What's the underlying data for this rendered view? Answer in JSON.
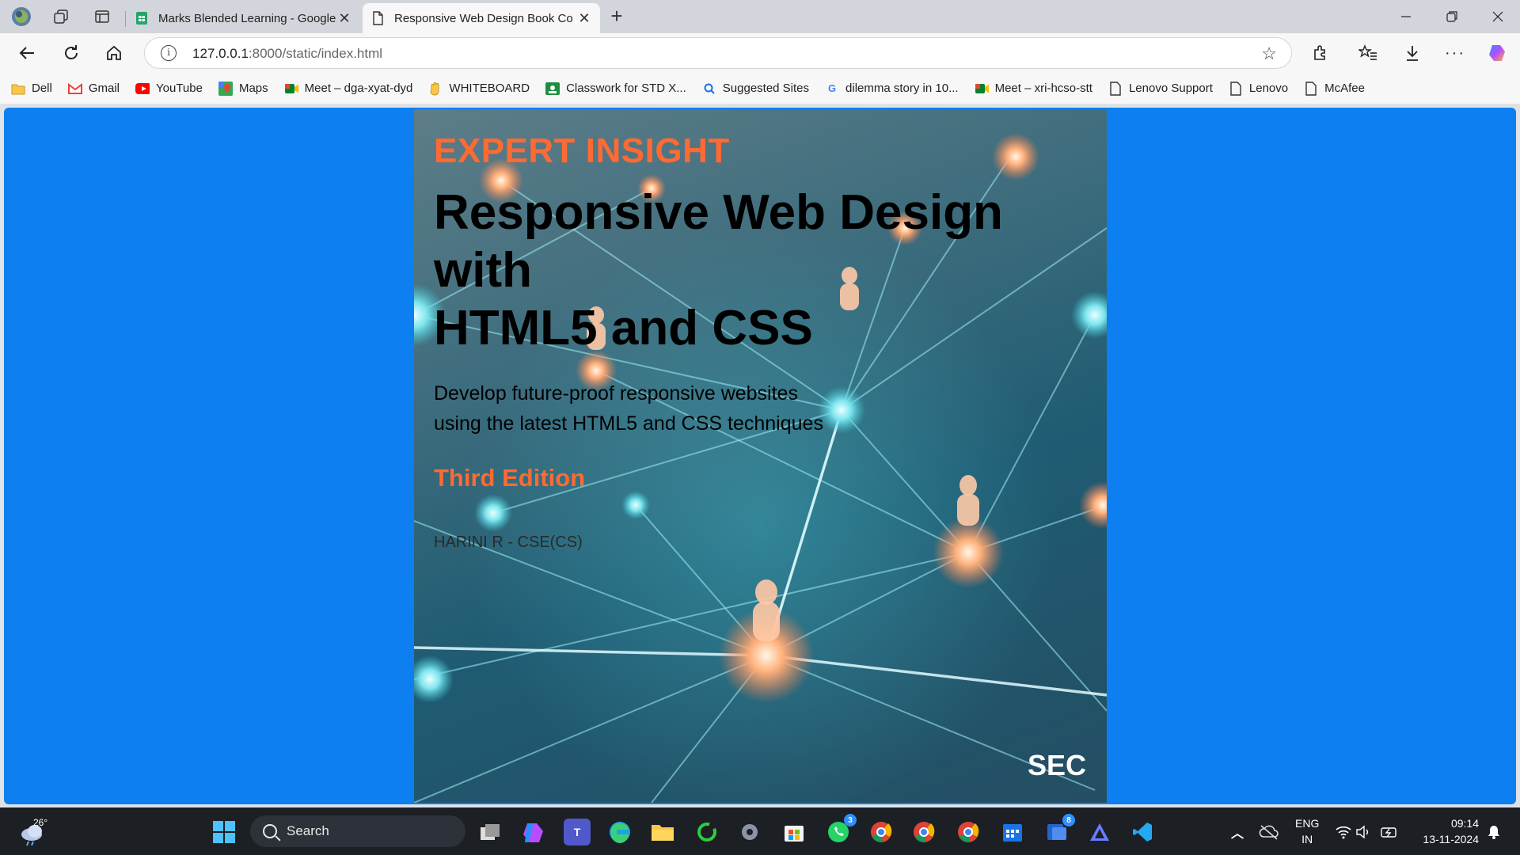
{
  "browser": {
    "tabs": [
      {
        "label": "Marks Blended Learning - Google",
        "active": false
      },
      {
        "label": "Responsive Web Design Book Co",
        "active": true
      }
    ],
    "url_host": "127.0.0.1",
    "url_path": ":8000/static/index.html",
    "bookmarks": [
      {
        "label": "Dell",
        "icon": "folder-icon"
      },
      {
        "label": "Gmail",
        "icon": "gmail-icon"
      },
      {
        "label": "YouTube",
        "icon": "youtube-icon"
      },
      {
        "label": "Maps",
        "icon": "maps-icon"
      },
      {
        "label": "Meet – dga-xyat-dyd",
        "icon": "meet-icon"
      },
      {
        "label": "WHITEBOARD",
        "icon": "hand-icon"
      },
      {
        "label": "Classwork for STD X...",
        "icon": "classroom-icon"
      },
      {
        "label": "Suggested Sites",
        "icon": "search-icon"
      },
      {
        "label": "dilemma story in 10...",
        "icon": "google-icon"
      },
      {
        "label": "Meet – xri-hcso-stt",
        "icon": "meet-icon"
      },
      {
        "label": "Lenovo Support",
        "icon": "page-icon"
      },
      {
        "label": "Lenovo",
        "icon": "page-icon"
      },
      {
        "label": "McAfee",
        "icon": "page-icon"
      }
    ]
  },
  "cover": {
    "series": "EXPERT INSIGHT",
    "title_line1": "Responsive Web Design",
    "title_line2": "with",
    "title_line3": "HTML5 and CSS",
    "subtitle_line1": "Develop future-proof responsive websites",
    "subtitle_line2": "using the latest HTML5 and CSS techniques",
    "edition": "Third Edition",
    "author": "HARINI R - CSE(CS)",
    "publisher": "SEC",
    "colors": {
      "accent": "#ff6a32",
      "page_bg": "#0d7ff0"
    }
  },
  "taskbar": {
    "weather": "26°",
    "search_placeholder": "Search",
    "whatsapp_badge": "3",
    "todo_badge": "8",
    "lang_line1": "ENG",
    "lang_line2": "IN",
    "time": "09:14",
    "date": "13-11-2024"
  }
}
